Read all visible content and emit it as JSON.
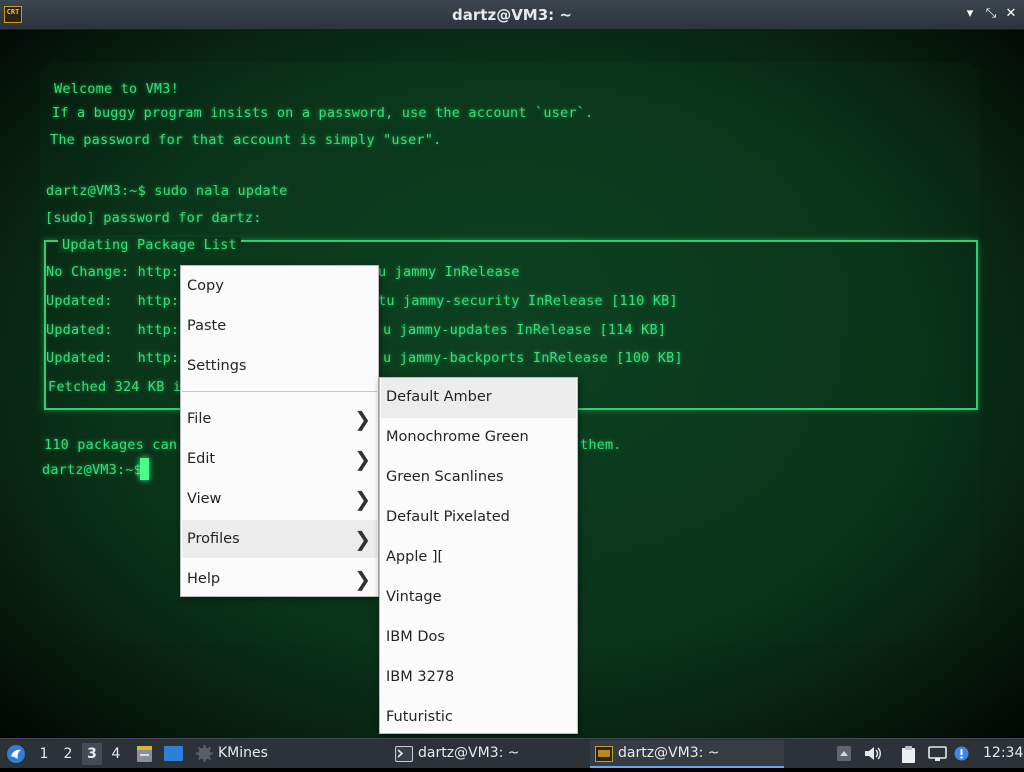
{
  "window": {
    "title": "dartz@VM3: ~",
    "app_icon_text": "CRT",
    "buttons": {
      "minimize": "▾",
      "maximize": "⤡",
      "close": "✕"
    }
  },
  "terminal": {
    "lines": [
      "Welcome to VM3!",
      "If a buggy program insists on a password, use the account `user`.",
      "The password for that account is simply \"user\".",
      "dartz@VM3:~$ sudo nala update",
      "[sudo] password for dartz:",
      "No Change: http://",
      "u jammy InRelease",
      "Updated:   http://",
      "tu jammy-security InRelease [110 KB]",
      "Updated:   http://",
      "u jammy-updates InRelease [114 KB]",
      "Updated:   http://",
      "u jammy-backports InRelease [100 KB]",
      "Fetched 324 KB in",
      "110 packages can b",
      "them.",
      "dartz@VM3:~$"
    ],
    "box_title": "Updating Package List",
    "colors": {
      "text": "#35e07a",
      "background": "#0a3319"
    }
  },
  "context_menu": {
    "items": [
      {
        "label": "Copy"
      },
      {
        "label": "Paste"
      },
      {
        "label": "Settings"
      },
      {
        "label": "File",
        "has_submenu": true
      },
      {
        "label": "Edit",
        "has_submenu": true
      },
      {
        "label": "View",
        "has_submenu": true
      },
      {
        "label": "Profiles",
        "has_submenu": true,
        "highlighted": true
      },
      {
        "label": "Help",
        "has_submenu": true
      }
    ],
    "submenu_arrow": "❯"
  },
  "profiles_submenu": {
    "items": [
      "Default Amber",
      "Monochrome Green",
      "Green Scanlines",
      "Default Pixelated",
      "Apple ][",
      "Vintage",
      "IBM Dos",
      "IBM 3278",
      "Futuristic"
    ],
    "highlighted": "Default Amber"
  },
  "taskbar": {
    "desktops": [
      "1",
      "2",
      "3",
      "4"
    ],
    "active_desktop": "3",
    "tasks": [
      {
        "label": "KMines",
        "icon": "kmines-icon"
      },
      {
        "label": "dartz@VM3: ~",
        "icon": "terminal-icon"
      },
      {
        "label": "dartz@VM3: ~",
        "icon": "crt-icon",
        "active": true
      }
    ],
    "clock": "12:34"
  }
}
